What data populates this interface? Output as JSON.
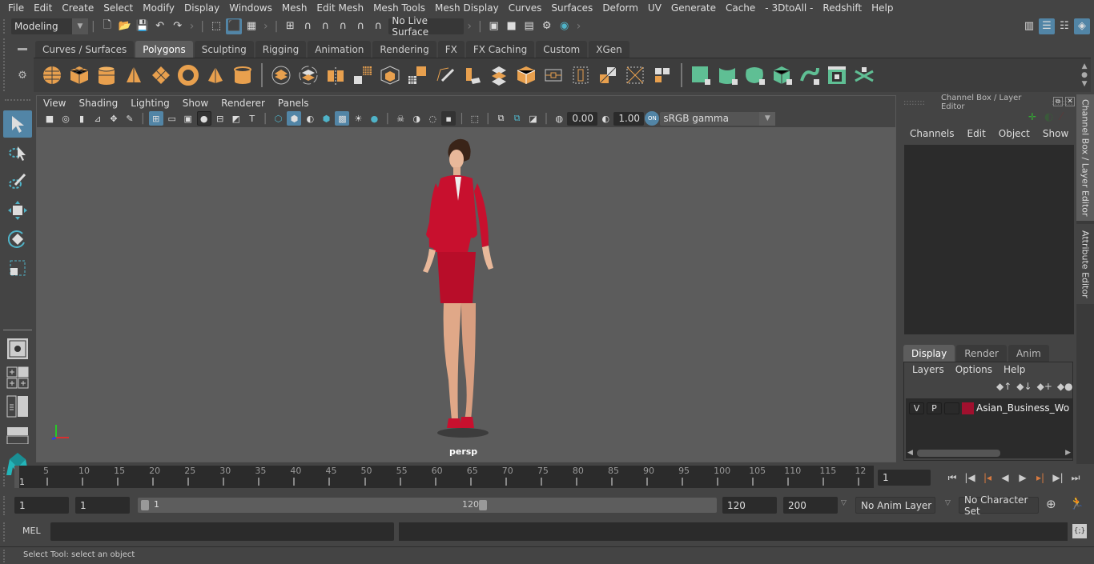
{
  "menubar": {
    "items": [
      "File",
      "Edit",
      "Create",
      "Select",
      "Modify",
      "Display",
      "Windows",
      "Mesh",
      "Edit Mesh",
      "Mesh Tools",
      "Mesh Display",
      "Curves",
      "Surfaces",
      "Deform",
      "UV",
      "Generate",
      "Cache",
      "- 3DtoAll -",
      "Redshift",
      "Help"
    ]
  },
  "statusline": {
    "workspace": "Modeling",
    "live_surface": "No Live Surface"
  },
  "shelf": {
    "tabs": [
      "Curves / Surfaces",
      "Polygons",
      "Sculpting",
      "Rigging",
      "Animation",
      "Rendering",
      "FX",
      "FX Caching",
      "Custom",
      "XGen"
    ],
    "active_tab": "Polygons",
    "colors": {
      "orange": "#e8a04e",
      "green": "#5fbf94"
    }
  },
  "viewport": {
    "menu": [
      "View",
      "Shading",
      "Lighting",
      "Show",
      "Renderer",
      "Panels"
    ],
    "exposure": "0.00",
    "gamma": "1.00",
    "color_toggle": "ON",
    "color_space": "sRGB gamma",
    "camera_label": "persp",
    "axis": {
      "x": "x",
      "y": "y",
      "z": "z"
    }
  },
  "channel_box": {
    "title": "Channel Box / Layer Editor",
    "menu": [
      "Channels",
      "Edit",
      "Object",
      "Show"
    ]
  },
  "layer_editor": {
    "tabs": [
      "Display",
      "Render",
      "Anim"
    ],
    "active_tab": "Display",
    "menu": [
      "Layers",
      "Options",
      "Help"
    ],
    "layers": [
      {
        "v": "V",
        "p": "P",
        "name": "Asian_Business_Woman",
        "color": "#a0102e"
      }
    ]
  },
  "side_tabs": [
    "Channel Box / Layer Editor",
    "Attribute Editor"
  ],
  "timeline": {
    "start_marker": "1",
    "ticks": [
      "5",
      "10",
      "15",
      "20",
      "25",
      "30",
      "35",
      "40",
      "45",
      "50",
      "55",
      "60",
      "65",
      "70",
      "75",
      "80",
      "85",
      "90",
      "95",
      "100",
      "105",
      "110",
      "115",
      "12"
    ],
    "current_frame": "1"
  },
  "range": {
    "start_time": "1",
    "playback_start": "1",
    "range_start_label": "1",
    "range_end_label": "120",
    "playback_end": "120",
    "end_time": "200",
    "anim_layer": "No Anim Layer",
    "character_set": "No Character Set"
  },
  "command_line": {
    "label": "MEL",
    "input": "",
    "result": ""
  },
  "status": {
    "help_text": "Select Tool: select an object"
  }
}
